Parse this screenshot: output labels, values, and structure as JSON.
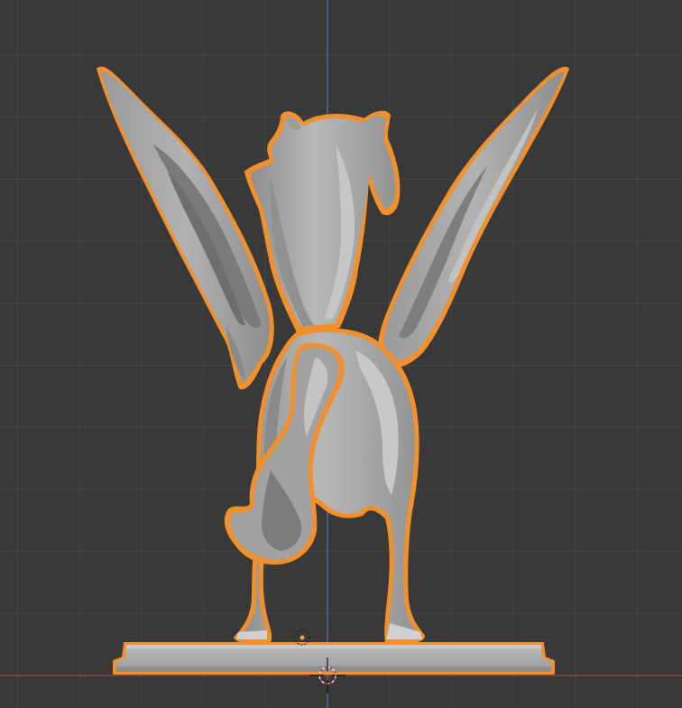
{
  "viewport": {
    "background": "#393939",
    "grid_minor_color": "#464646",
    "grid_major_color": "#4c4c4c",
    "axis_z_color": "#5b7fc4",
    "axis_x_color": "#b0484f",
    "selection_outline_color": "#f2902c",
    "object_fill_color": "#a8a8a8",
    "object_shade_color": "#8c8c8c",
    "object_highlight_color": "#c4c4c4"
  },
  "scene_object": {
    "name": "pegasus-statue",
    "selected": true
  },
  "gizmos": {
    "cursor_icon": "3d-cursor-icon",
    "origin_icon": "object-origin-icon"
  }
}
